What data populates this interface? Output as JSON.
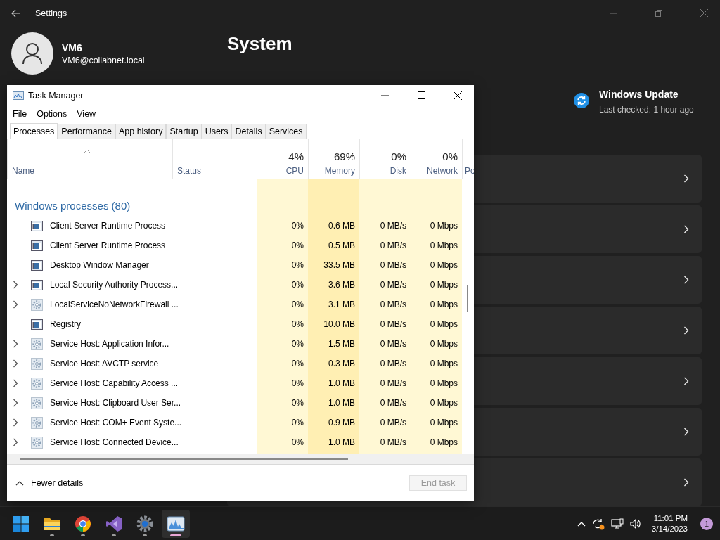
{
  "settings": {
    "title": "Settings",
    "user": {
      "name": "VM6",
      "email": "VM6@collabnet.local"
    },
    "page_title": "System",
    "update": {
      "title": "Windows Update",
      "status": "Last checked: 1 hour ago"
    }
  },
  "task_manager": {
    "title": "Task Manager",
    "menu": [
      "File",
      "Options",
      "View"
    ],
    "tabs": [
      {
        "label": "Processes",
        "selected": true
      },
      {
        "label": "Performance",
        "selected": false
      },
      {
        "label": "App history",
        "selected": false
      },
      {
        "label": "Startup",
        "selected": false
      },
      {
        "label": "Users",
        "selected": false
      },
      {
        "label": "Details",
        "selected": false
      },
      {
        "label": "Services",
        "selected": false
      }
    ],
    "columns": [
      {
        "label": "Name"
      },
      {
        "label": "Status"
      },
      {
        "label": "CPU",
        "total": "4%"
      },
      {
        "label": "Memory",
        "total": "69%"
      },
      {
        "label": "Disk",
        "total": "0%"
      },
      {
        "label": "Network",
        "total": "0%"
      },
      {
        "label": "Po"
      }
    ],
    "group": {
      "label": "Windows processes (80)"
    },
    "rows": [
      {
        "name": "Client Server Runtime Process",
        "kind": "window",
        "expandable": false,
        "cpu": "0%",
        "memory": "0.6 MB",
        "disk": "0 MB/s",
        "network": "0 Mbps"
      },
      {
        "name": "Client Server Runtime Process",
        "kind": "window",
        "expandable": false,
        "cpu": "0%",
        "memory": "0.5 MB",
        "disk": "0 MB/s",
        "network": "0 Mbps"
      },
      {
        "name": "Desktop Window Manager",
        "kind": "window",
        "expandable": false,
        "cpu": "0%",
        "memory": "33.5 MB",
        "disk": "0 MB/s",
        "network": "0 Mbps"
      },
      {
        "name": "Local Security Authority Process...",
        "kind": "window",
        "expandable": true,
        "cpu": "0%",
        "memory": "3.6 MB",
        "disk": "0 MB/s",
        "network": "0 Mbps"
      },
      {
        "name": "LocalServiceNoNetworkFirewall ...",
        "kind": "service",
        "expandable": true,
        "cpu": "0%",
        "memory": "3.1 MB",
        "disk": "0 MB/s",
        "network": "0 Mbps"
      },
      {
        "name": "Registry",
        "kind": "window",
        "expandable": false,
        "cpu": "0%",
        "memory": "10.0 MB",
        "disk": "0 MB/s",
        "network": "0 Mbps"
      },
      {
        "name": "Service Host: Application Infor...",
        "kind": "service",
        "expandable": true,
        "cpu": "0%",
        "memory": "1.5 MB",
        "disk": "0 MB/s",
        "network": "0 Mbps"
      },
      {
        "name": "Service Host: AVCTP service",
        "kind": "service",
        "expandable": true,
        "cpu": "0%",
        "memory": "0.3 MB",
        "disk": "0 MB/s",
        "network": "0 Mbps"
      },
      {
        "name": "Service Host: Capability Access ...",
        "kind": "service",
        "expandable": true,
        "cpu": "0%",
        "memory": "1.0 MB",
        "disk": "0 MB/s",
        "network": "0 Mbps"
      },
      {
        "name": "Service Host: Clipboard User Ser...",
        "kind": "service",
        "expandable": true,
        "cpu": "0%",
        "memory": "1.0 MB",
        "disk": "0 MB/s",
        "network": "0 Mbps"
      },
      {
        "name": "Service Host: COM+ Event Syste...",
        "kind": "service",
        "expandable": true,
        "cpu": "0%",
        "memory": "0.9 MB",
        "disk": "0 MB/s",
        "network": "0 Mbps"
      },
      {
        "name": "Service Host: Connected Device...",
        "kind": "service",
        "expandable": true,
        "cpu": "0%",
        "memory": "1.0 MB",
        "disk": "0 MB/s",
        "network": "0 Mbps"
      }
    ],
    "footer": {
      "toggle": "Fewer details",
      "end_task": {
        "label": "End task",
        "disabled": true
      }
    }
  },
  "taskbar": {
    "apps": [
      {
        "kind": "start",
        "running": false,
        "selected": false
      },
      {
        "kind": "explorer",
        "running": true,
        "selected": false
      },
      {
        "kind": "browser",
        "running": true,
        "selected": false
      },
      {
        "kind": "studio",
        "running": true,
        "selected": false
      },
      {
        "kind": "settings",
        "running": true,
        "selected": false
      },
      {
        "kind": "taskmanager",
        "running": true,
        "selected": true
      }
    ],
    "tray": {
      "time": "11:01 PM",
      "date": "3/14/2023",
      "notifications": "1"
    }
  }
}
